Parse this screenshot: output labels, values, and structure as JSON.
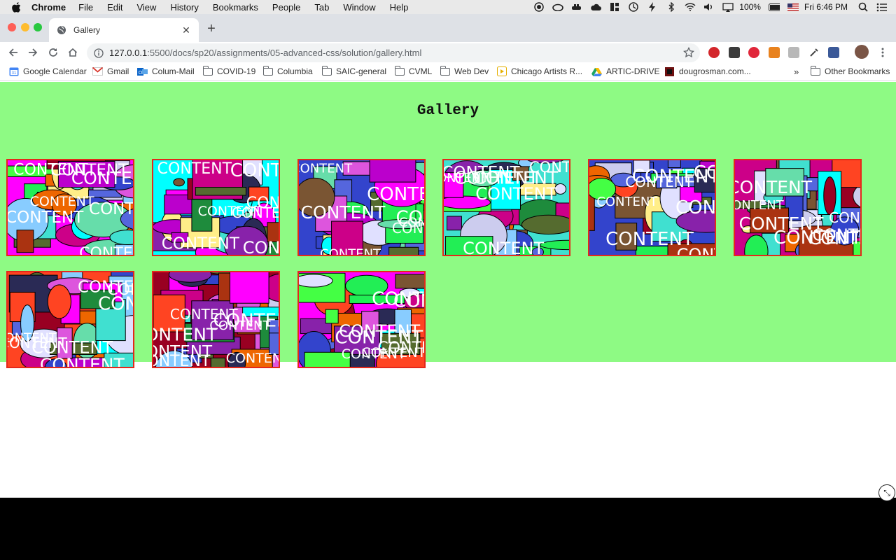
{
  "menubar": {
    "app": "Chrome",
    "items": [
      "File",
      "Edit",
      "View",
      "History",
      "Bookmarks",
      "People",
      "Tab",
      "Window",
      "Help"
    ],
    "battery": "100%",
    "clock": "Fri 6:46 PM"
  },
  "browser": {
    "tab_title": "Gallery",
    "url_host": "127.0.0.1",
    "url_path": ":5500/docs/sp20/assignments/05-advanced-css/solution/gallery.html",
    "bookmarks": [
      {
        "label": "Google Calendar",
        "icon": "calendar-icon"
      },
      {
        "label": "Gmail",
        "icon": "gmail-icon"
      },
      {
        "label": "Colum-Mail",
        "icon": "outlook-icon"
      },
      {
        "label": "COVID-19",
        "icon": "folder-icon"
      },
      {
        "label": "Columbia",
        "icon": "folder-icon"
      },
      {
        "label": "SAIC-general",
        "icon": "folder-icon"
      },
      {
        "label": "CVML",
        "icon": "folder-icon"
      },
      {
        "label": "Web Dev",
        "icon": "folder-icon"
      },
      {
        "label": "Chicago Artists R...",
        "icon": "play-icon"
      },
      {
        "label": "ARTIC-DRIVE",
        "icon": "drive-icon"
      },
      {
        "label": "dougrosman.com...",
        "icon": "site-icon"
      }
    ],
    "overflow": "»",
    "other_bookmarks": "Other Bookmarks"
  },
  "page": {
    "title": "Gallery",
    "thumbnail_word": "CONTENT",
    "thumbnail_count": 9
  },
  "colors": {
    "page_background": "#8efa84",
    "thumbnail_border": "#e4281b"
  }
}
